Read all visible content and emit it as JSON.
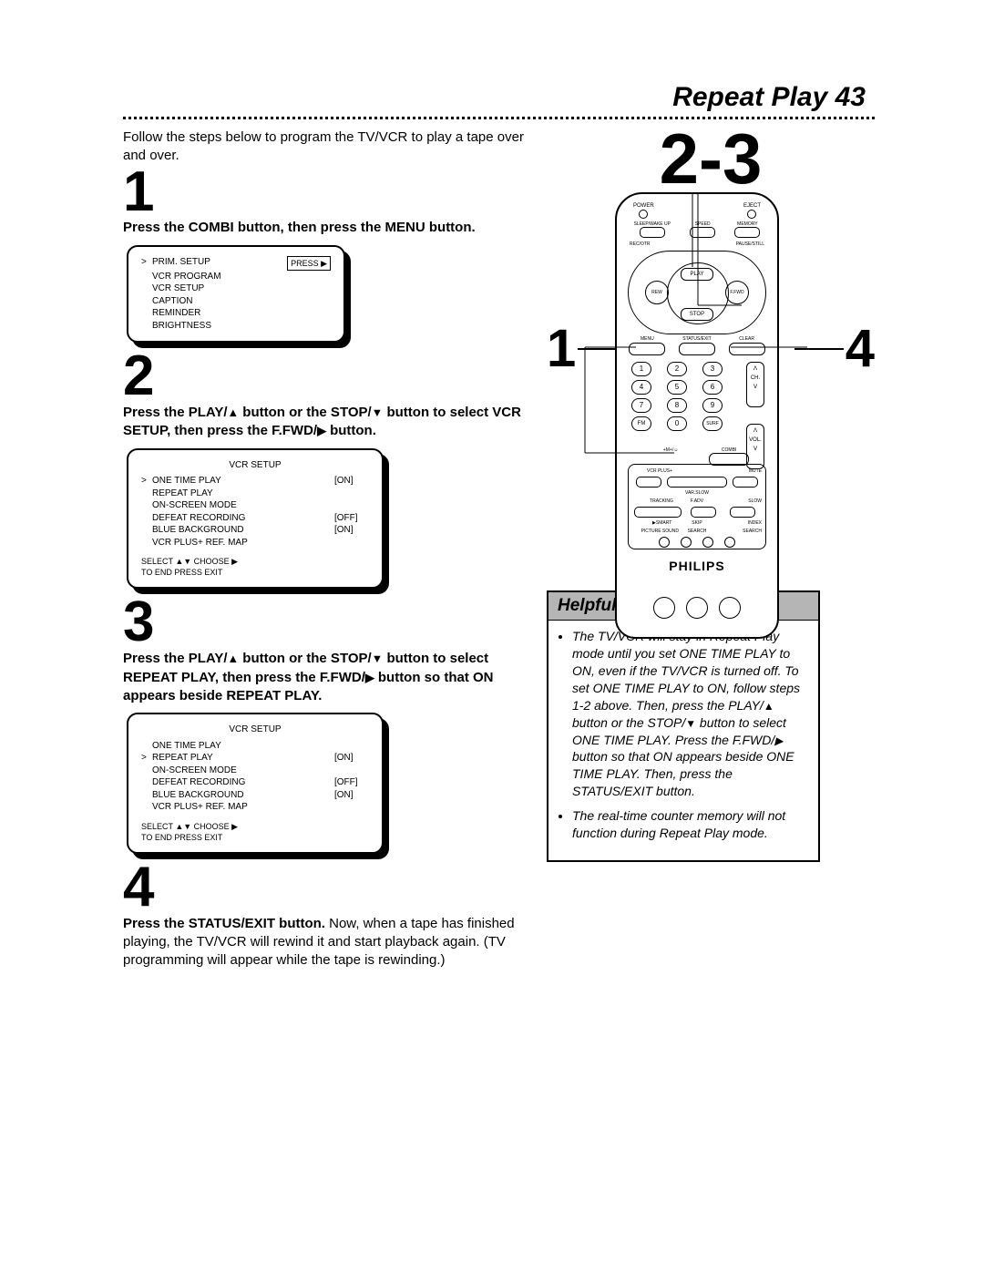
{
  "header": {
    "title": "Repeat Play",
    "page_no": "43"
  },
  "intro": "Follow the steps below to program the TV/VCR to play a tape over and over.",
  "steps": {
    "s1": {
      "num": "1",
      "text": "Press the COMBI button, then press the MENU button."
    },
    "s2": {
      "num": "2",
      "text_a": "Press the PLAY/",
      "text_b": " button or the STOP/",
      "text_c": " button to select VCR SETUP, then press the F.FWD/",
      "text_d": " button."
    },
    "s3": {
      "num": "3",
      "text_a": "Press the PLAY/",
      "text_b": " button or the STOP/",
      "text_c": " button to select REPEAT PLAY, then press the F.FWD/",
      "text_d": " button so that ON appears beside REPEAT PLAY."
    },
    "s4": {
      "num": "4",
      "bold": "Press the STATUS/EXIT button.",
      "rest": "  Now, when a tape has finished playing, the TV/VCR will rewind it and start playback again. (TV programming will appear while the tape is rewinding.)"
    }
  },
  "osd1": {
    "press_label": "PRESS ▶",
    "items": [
      "PRIM. SETUP",
      "VCR PROGRAM",
      "VCR SETUP",
      "CAPTION",
      "REMINDER",
      "BRIGHTNESS"
    ]
  },
  "osd2": {
    "title": "VCR SETUP",
    "rows": [
      {
        "mark": ">",
        "label": "ONE TIME PLAY",
        "val": "[ON]"
      },
      {
        "mark": "",
        "label": "REPEAT PLAY",
        "val": ""
      },
      {
        "mark": "",
        "label": "ON-SCREEN MODE",
        "val": ""
      },
      {
        "mark": "",
        "label": "DEFEAT RECORDING",
        "val": "[OFF]"
      },
      {
        "mark": "",
        "label": "BLUE BACKGROUND",
        "val": "[ON]"
      },
      {
        "mark": "",
        "label": "VCR PLUS+ REF. MAP",
        "val": ""
      }
    ],
    "foot1": "SELECT ▲▼ CHOOSE ▶",
    "foot2": "TO END PRESS EXIT"
  },
  "osd3": {
    "title": "VCR SETUP",
    "rows": [
      {
        "mark": "",
        "label": "ONE TIME PLAY",
        "val": ""
      },
      {
        "mark": ">",
        "label": "REPEAT PLAY",
        "val": "[ON]"
      },
      {
        "mark": "",
        "label": "ON-SCREEN MODE",
        "val": ""
      },
      {
        "mark": "",
        "label": "DEFEAT RECORDING",
        "val": "[OFF]"
      },
      {
        "mark": "",
        "label": "BLUE BACKGROUND",
        "val": "[ON]"
      },
      {
        "mark": "",
        "label": "VCR PLUS+ REF. MAP",
        "val": ""
      }
    ],
    "foot1": "SELECT ▲▼ CHOOSE ▶",
    "foot2": "TO END PRESS EXIT"
  },
  "remote": {
    "big": "2-3",
    "left": "1",
    "right": "4",
    "brand": "PHILIPS",
    "top": {
      "power": "POWER",
      "eject": "EJECT"
    },
    "row2": {
      "a": "SLEEP/WAKE UP",
      "b": "SPEED",
      "c": "MEMORY"
    },
    "row2b": {
      "a": "REC/OTR",
      "b": "PAUSE/STILL"
    },
    "play": "PLAY",
    "stop": "STOP",
    "rew": "REW",
    "ffwd": "F.FWD",
    "menu": "MENU",
    "status": "STATUS/EXIT",
    "clear": "CLEAR",
    "nums": [
      "1",
      "2",
      "3",
      "4",
      "5",
      "6",
      "7",
      "8",
      "9",
      "FM",
      "0",
      "SURF"
    ],
    "ch": "CH.",
    "vol": "VOL.",
    "smiley": "+M+/☺",
    "combi": "COMBI",
    "vcrplus": "VCR PLUS+",
    "mute": "MUTE",
    "varslow": "VAR.SLOW",
    "tracking": "TRACKING",
    "fadv": "F.ADV",
    "slow": "SLOW",
    "p1": "▶SMART",
    "p2": "SKIP",
    "p3": "INDEX",
    "p1b": "PICTURE SOUND",
    "p2b": "SEARCH",
    "p3b": "SEARCH"
  },
  "hints": {
    "title": "Helpful Hints",
    "h1_a": "The TV/VCR will stay in Repeat Play mode until you set ONE TIME PLAY to ON, even if the TV/VCR is turned off. To set ONE TIME PLAY to ON, follow steps 1-2 above. Then, press the PLAY/",
    "h1_b": " button or the STOP/",
    "h1_c": " button to select ONE TIME PLAY. Press the F.FWD/",
    "h1_d": " button so that ON appears beside ONE TIME PLAY. Then, press the STATUS/EXIT button.",
    "h2": "The real-time counter memory will not function during Repeat Play mode."
  }
}
